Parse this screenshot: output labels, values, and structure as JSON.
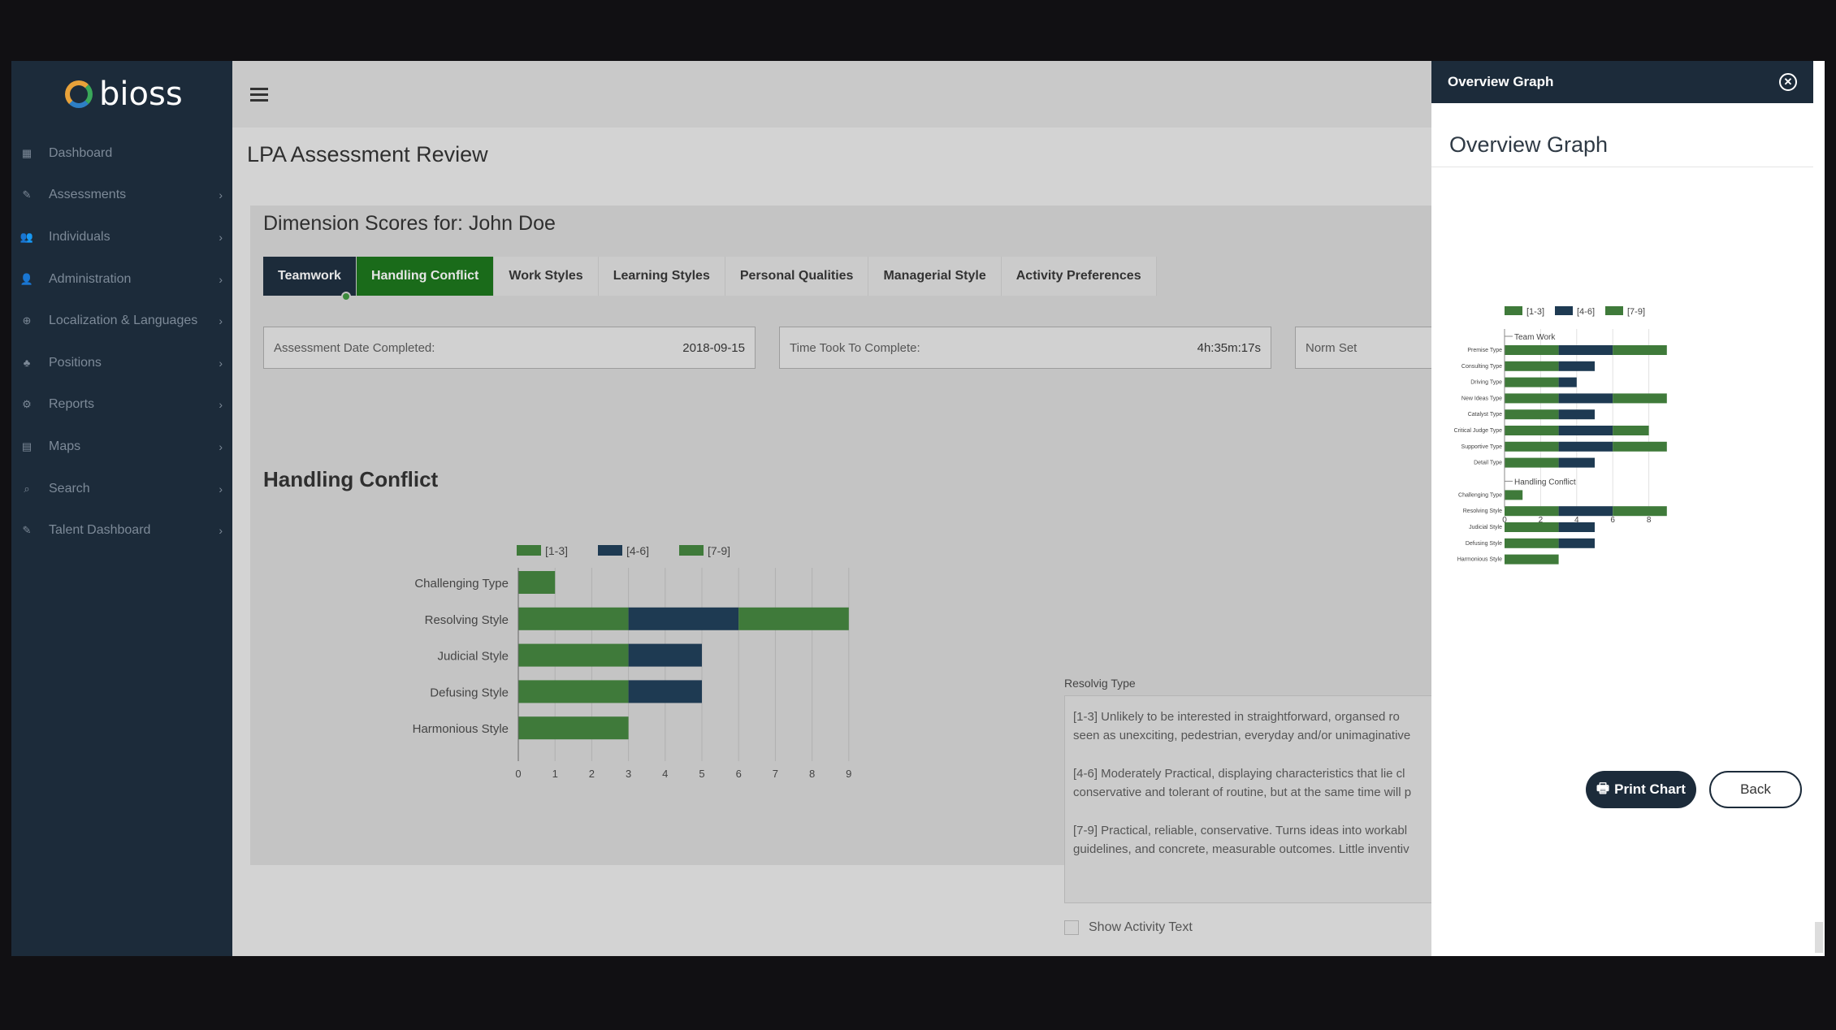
{
  "brand": {
    "name": "bioss"
  },
  "sidebar": {
    "items": [
      {
        "label": "Dashboard",
        "icon": "dashboard-icon",
        "chevron": false
      },
      {
        "label": "Assessments",
        "icon": "edit-icon",
        "chevron": true
      },
      {
        "label": "Individuals",
        "icon": "users-icon",
        "chevron": true
      },
      {
        "label": "Administration",
        "icon": "user-icon",
        "chevron": true
      },
      {
        "label": "Localization & Languages",
        "icon": "globe-icon",
        "chevron": true
      },
      {
        "label": "Positions",
        "icon": "sitemap-icon",
        "chevron": true
      },
      {
        "label": "Reports",
        "icon": "cogs-icon",
        "chevron": true
      },
      {
        "label": "Maps",
        "icon": "map-icon",
        "chevron": true
      },
      {
        "label": "Search",
        "icon": "search-icon",
        "chevron": true
      },
      {
        "label": "Talent Dashboard",
        "icon": "edit-icon",
        "chevron": true
      }
    ]
  },
  "page": {
    "title": "LPA Assessment Review"
  },
  "card": {
    "title": "Dimension Scores for: John Doe"
  },
  "tabs": [
    "Teamwork",
    "Handling Conflict",
    "Work Styles",
    "Learning Styles",
    "Personal Qualities",
    "Managerial Style",
    "Activity Preferences"
  ],
  "fields": [
    {
      "label": "Assessment Date Completed:",
      "value": "2018-09-15"
    },
    {
      "label": "Time Took To Complete:",
      "value": "4h:35m:17s"
    },
    {
      "label": "Norm Set",
      "value": ""
    }
  ],
  "section": {
    "title": "Handling Conflict"
  },
  "description": {
    "label": "Resolvig Type",
    "paragraphs": [
      [
        "[1-3] Unlikely to be interested in straightforward, organsed ro",
        "seen as unexciting, pedestrian, everyday and/or unimaginative"
      ],
      [
        "[4-6] Moderately Practical, displaying characteristics that lie cl",
        "conservative and tolerant of routine, but at the same time will p"
      ],
      [
        "[7-9] Practical, reliable, conservative. Turns ideas into workabl",
        "guidelines, and concrete, measurable outcomes. Little inventiv"
      ]
    ]
  },
  "checkbox": {
    "label": "Show Activity Text"
  },
  "panel": {
    "header": "Overview Graph",
    "title": "Overview Graph",
    "print_label": "Print Chart",
    "back_label": "Back"
  },
  "colors": {
    "green": "#3f7a3a",
    "navy": "#1e3a52",
    "sidebar": "#1c2b3a",
    "active_tab": "#1a6b1a"
  },
  "chart_data": [
    {
      "type": "bar",
      "stacked": true,
      "orientation": "horizontal",
      "legend": [
        "[1-3]",
        "[4-6]",
        "[7-9]"
      ],
      "legend_position": "top",
      "categories": [
        "Challenging Type",
        "Resolving Style",
        "Judicial Style",
        "Defusing Style",
        "Harmonious Style"
      ],
      "values": [
        1,
        9,
        5,
        5,
        3
      ],
      "band_edges": [
        3,
        6
      ],
      "xlim": [
        0,
        9
      ],
      "xticks": [
        0,
        1,
        2,
        3,
        4,
        5,
        6,
        7,
        8,
        9
      ]
    },
    {
      "type": "bar",
      "stacked": true,
      "orientation": "horizontal",
      "legend": [
        "[1-3]",
        "[4-6]",
        "[7-9]"
      ],
      "legend_position": "top",
      "groups": [
        {
          "name": "Team Work",
          "categories": [
            "Premise Type",
            "Consulting Type",
            "Driving Type",
            "New Ideas Type",
            "Catalyst Type",
            "Critical Judge Type",
            "Supportive Type",
            "Detail Type"
          ],
          "values": [
            9,
            5,
            4,
            9,
            5,
            8,
            9,
            5
          ]
        },
        {
          "name": "Handling Conflict",
          "categories": [
            "Challenging Type",
            "Resolving Style",
            "Judicial Style",
            "Defusing Style",
            "Harmonious Style"
          ],
          "values": [
            1,
            9,
            5,
            5,
            3
          ]
        }
      ],
      "band_edges": [
        3,
        6
      ],
      "xlim": [
        0,
        9
      ],
      "xticks": [
        0,
        2,
        4,
        6,
        8
      ]
    }
  ]
}
